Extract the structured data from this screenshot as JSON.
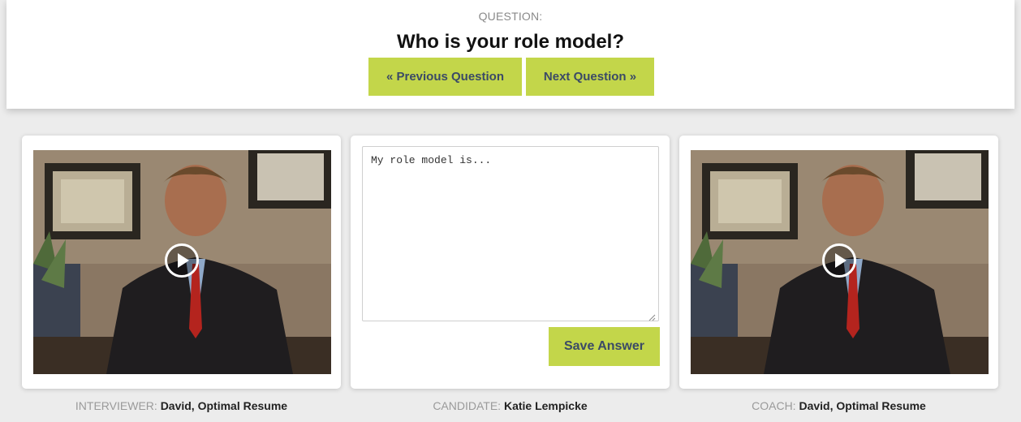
{
  "question": {
    "label": "QUESTION:",
    "title": "Who is your role model?",
    "prev_label": "« Previous Question",
    "next_label": "Next Question »"
  },
  "answer": {
    "text": "My role model is...",
    "save_label": "Save Answer"
  },
  "captions": {
    "interviewer_role": "INTERVIEWER:",
    "interviewer_name": "David, Optimal Resume",
    "candidate_role": "CANDIDATE:",
    "candidate_name": "Katie Lempicke",
    "coach_role": "COACH:",
    "coach_name": "David, Optimal Resume"
  },
  "colors": {
    "accent": "#c3d64a",
    "button_text": "#3b4a66",
    "background": "#ececec"
  },
  "icons": {
    "play": "play-icon"
  }
}
